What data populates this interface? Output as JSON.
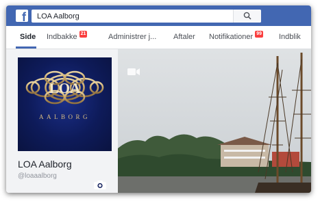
{
  "header": {
    "logo_letter": "f",
    "search": {
      "value": "LOA Aalborg",
      "icon": "search-icon"
    }
  },
  "tabs": [
    {
      "label": "Side",
      "active": true
    },
    {
      "label": "Indbakke",
      "badge": "21"
    },
    {
      "label": "Administrer j..."
    },
    {
      "label": "Aftaler"
    },
    {
      "label": "Notifikationer",
      "badge": "99"
    },
    {
      "label": "Indblik"
    }
  ],
  "profile": {
    "logo_text": "LOA",
    "logo_subtext": "AALBORG",
    "name": "LOA Aalborg",
    "handle": "@loaaalborg",
    "camera_icon": "camera-icon"
  },
  "cover": {
    "video_icon": "video-camera-icon"
  },
  "colors": {
    "brand": "#4267b2",
    "badge": "#fa3e3e",
    "logo_gold": "#c9a86a",
    "logo_bg": "#0e1b5a"
  }
}
